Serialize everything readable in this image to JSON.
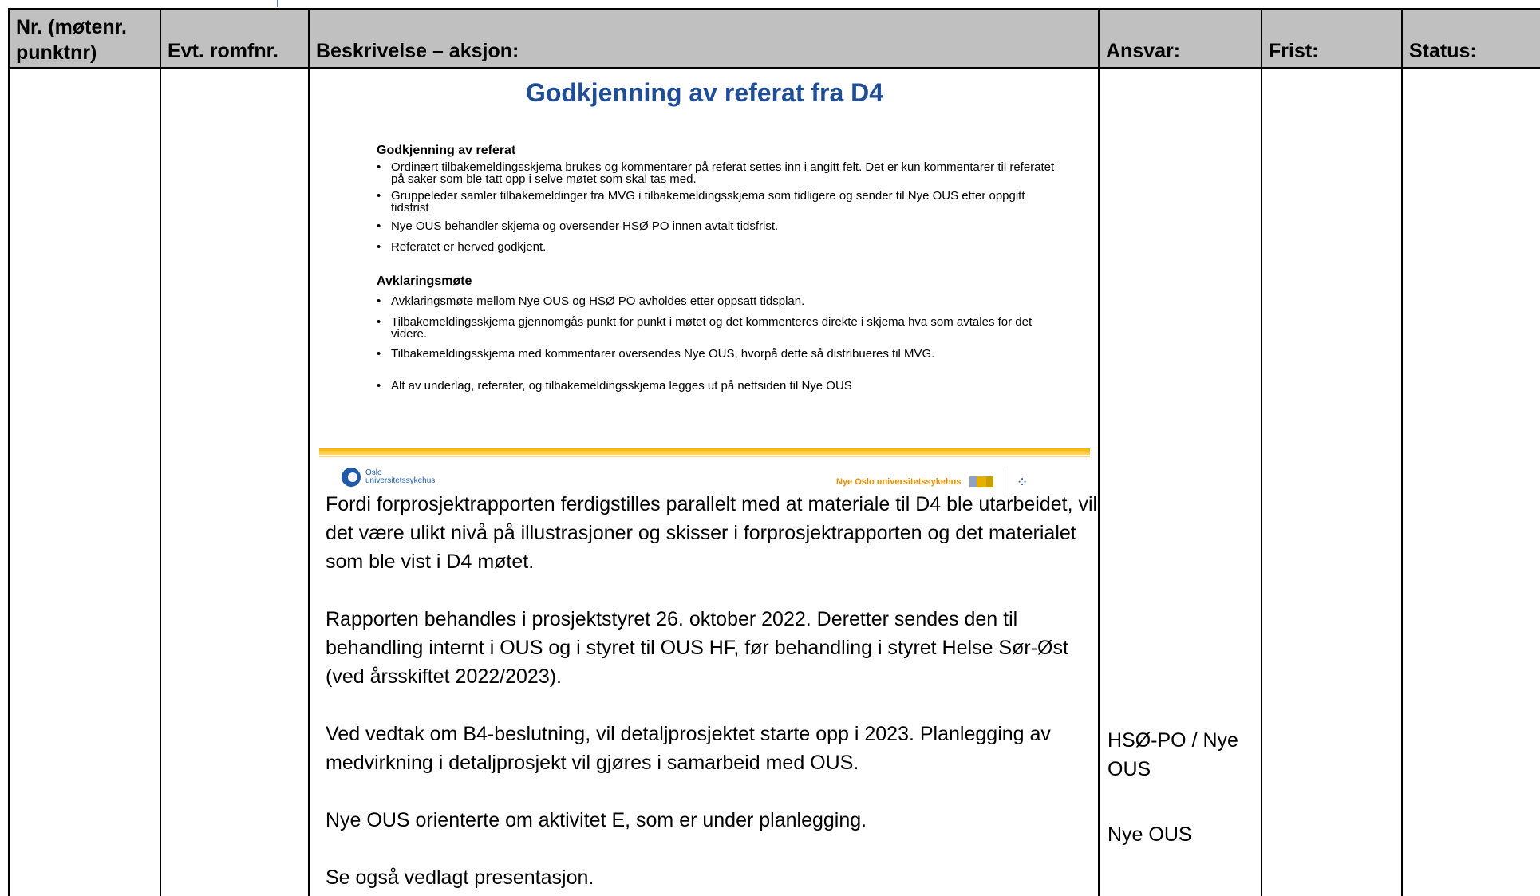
{
  "table": {
    "headers": [
      "Nr. (møtenr.\npunktnr)",
      "Evt. romfnr.",
      "Beskrivelse – aksjon:",
      "Ansvar:",
      "Frist:",
      "Status:"
    ]
  },
  "slide": {
    "title": "Godkjenning av referat fra D4",
    "section1_title": "Godkjenning av referat",
    "section1_bullets": [
      "Ordinært tilbakemeldingsskjema brukes og kommentarer på referat settes inn i angitt felt. Det er kun kommentarer til referatet på saker som ble tatt opp i selve møtet som skal tas med.",
      "Gruppeleder samler  tilbakemeldinger fra MVG i tilbakemeldingsskjema som tidligere og sender til Nye OUS etter oppgitt tidsfrist",
      "Nye OUS behandler skjema og oversender HSØ PO innen avtalt tidsfrist.",
      "Referatet er herved godkjent."
    ],
    "section2_title": "Avklaringsmøte",
    "section2_bullets": [
      "Avklaringsmøte mellom Nye OUS og HSØ PO avholdes etter oppsatt tidsplan.",
      "Tilbakemeldingsskjema gjennomgås punkt for punkt i møtet og det kommenteres direkte i skjema hva som avtales for det videre.",
      "Tilbakemeldingsskjema med kommentarer oversendes Nye OUS, hvorpå dette så distribueres til MVG.",
      "Alt av underlag, referater, og tilbakemeldingsskjema legges ut på nettsiden til Nye OUS"
    ],
    "footer_left": "Oslo\nuniversitetssykehus",
    "footer_right": "Nye Oslo universitetssykehus"
  },
  "paragraphs": [
    "Fordi forprosjektrapporten ferdigstilles parallelt med at materiale til D4 ble utarbeidet, vil det være ulikt nivå på illustrasjoner og skisser i forprosjektrapporten og det materialet som ble vist i D4 møtet.",
    "Rapporten behandles i prosjektstyret 26. oktober 2022. Deretter sendes den til behandling internt i OUS og i styret til OUS HF, før behandling i styret Helse Sør-Øst (ved årsskiftet 2022/2023).",
    "Ved vedtak om B4-beslutning, vil detaljprosjektet starte opp i 2023. Planlegging av medvirkning i detaljprosjekt vil gjøres i samarbeid med OUS.",
    "Nye OUS orienterte om aktivitet E, som er under planlegging.",
    "Se også vedlagt presentasjon."
  ],
  "ansvar": {
    "detaljprosjekt": "HSØ-PO / Nye OUS",
    "aktivitet_e": "Nye OUS"
  }
}
